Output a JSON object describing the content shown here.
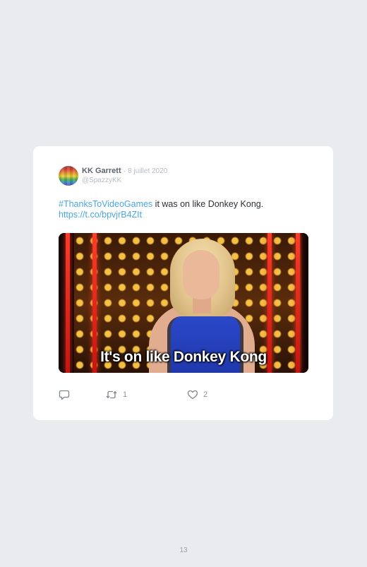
{
  "tweet": {
    "author_name": "KK Garrett",
    "separator": "·",
    "date": "8 juillet 2020",
    "handle": "@SpazzyKK",
    "hashtag": "#ThanksToVideoGames",
    "text_body": " it was on like Donkey Kong.",
    "link": "https://t.co/bpvjrB4ZIt",
    "media_caption": "It's on like Donkey Kong",
    "actions": {
      "reply_icon": "reply-icon",
      "retweet_icon": "retweet-icon",
      "retweet_count": "1",
      "like_icon": "heart-icon",
      "like_count": "2"
    }
  },
  "page": {
    "number": "13"
  },
  "colors": {
    "background": "#e9ebef",
    "card": "#ffffff",
    "link": "#4aa7e4",
    "muted": "#b6bcc6"
  }
}
